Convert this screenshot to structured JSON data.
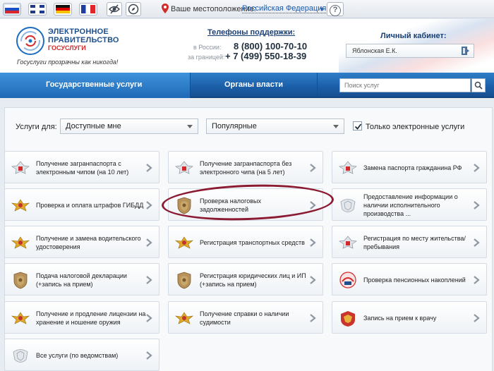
{
  "topbar": {
    "languages": [
      "ru",
      "en",
      "de",
      "fr"
    ],
    "location_label": "Ваше местоположение:",
    "location_value": "Российская Федерация",
    "help_label": "?"
  },
  "header": {
    "logo_line1": "ЭЛЕКТРОННОЕ",
    "logo_line2": "ПРАВИТЕЛЬСТВО",
    "logo_line3": "ГОСУСЛУГИ",
    "slogan": "Госуслуги прозрачны как никогда!",
    "phones_title": "Телефоны поддержки:",
    "phone1_label": "в России:",
    "phone1_value": "8 (800) 100-70-10",
    "phone2_label": "за границей:",
    "phone2_value": "+ 7 (499) 550-18-39",
    "cabinet_title": "Личный кабинет:",
    "cabinet_user": "Яблонская Е.К."
  },
  "nav": {
    "tab1": "Государственные услуги",
    "tab2": "Органы власти",
    "search_placeholder": "Поиск услуг"
  },
  "filters": {
    "label": "Услуги для:",
    "audience": "Доступные мне",
    "sort": "Популярные",
    "only_electronic": "Только электронные услуги",
    "only_electronic_checked": true
  },
  "tiles": [
    {
      "label": "Получение загранпаспорта с электронным чипом (на 10 лет)",
      "icon": "eagle-emblem-icon"
    },
    {
      "label": "Получение загранпаспорта без электронного чипа (на 5 лет)",
      "icon": "eagle-emblem-icon"
    },
    {
      "label": "Замена паспорта гражданина РФ",
      "icon": "eagle-emblem-icon"
    },
    {
      "label": "Проверка и оплата штрафов ГИБДД",
      "icon": "police-eagle-icon"
    },
    {
      "label": "Проверка налоговых задолженностей",
      "icon": "tax-eagle-icon"
    },
    {
      "label": "Предоставление информации о наличии исполнительного производства ...",
      "icon": "coat-of-arms-icon"
    },
    {
      "label": "Получение и замена водительского удостоверения",
      "icon": "police-eagle-icon"
    },
    {
      "label": "Регистрация транспортных средств",
      "icon": "police-eagle-icon"
    },
    {
      "label": "Регистрация по месту жительства/пребывания",
      "icon": "eagle-emblem-icon"
    },
    {
      "label": "Подача налоговой декларации (+запись на прием)",
      "icon": "tax-eagle-icon"
    },
    {
      "label": "Регистрация юридических лиц и ИП (+запись на прием)",
      "icon": "tax-eagle-icon"
    },
    {
      "label": "Проверка пенсионных накоплений",
      "icon": "pension-fund-icon"
    },
    {
      "label": "Получение и продление лицензии на хранение и ношение оружия",
      "icon": "police-eagle-icon"
    },
    {
      "label": "Получение справки о наличии судимости",
      "icon": "police-eagle-icon"
    },
    {
      "label": "Запись на прием к врачу",
      "icon": "red-eagle-icon"
    },
    {
      "label": "Все услуги (по ведомствам)",
      "icon": "coat-of-arms-icon"
    }
  ],
  "colors": {
    "nav_blue": "#1b5ea8",
    "highlight": "#8b1a33",
    "link_blue": "#1a5aa8"
  }
}
